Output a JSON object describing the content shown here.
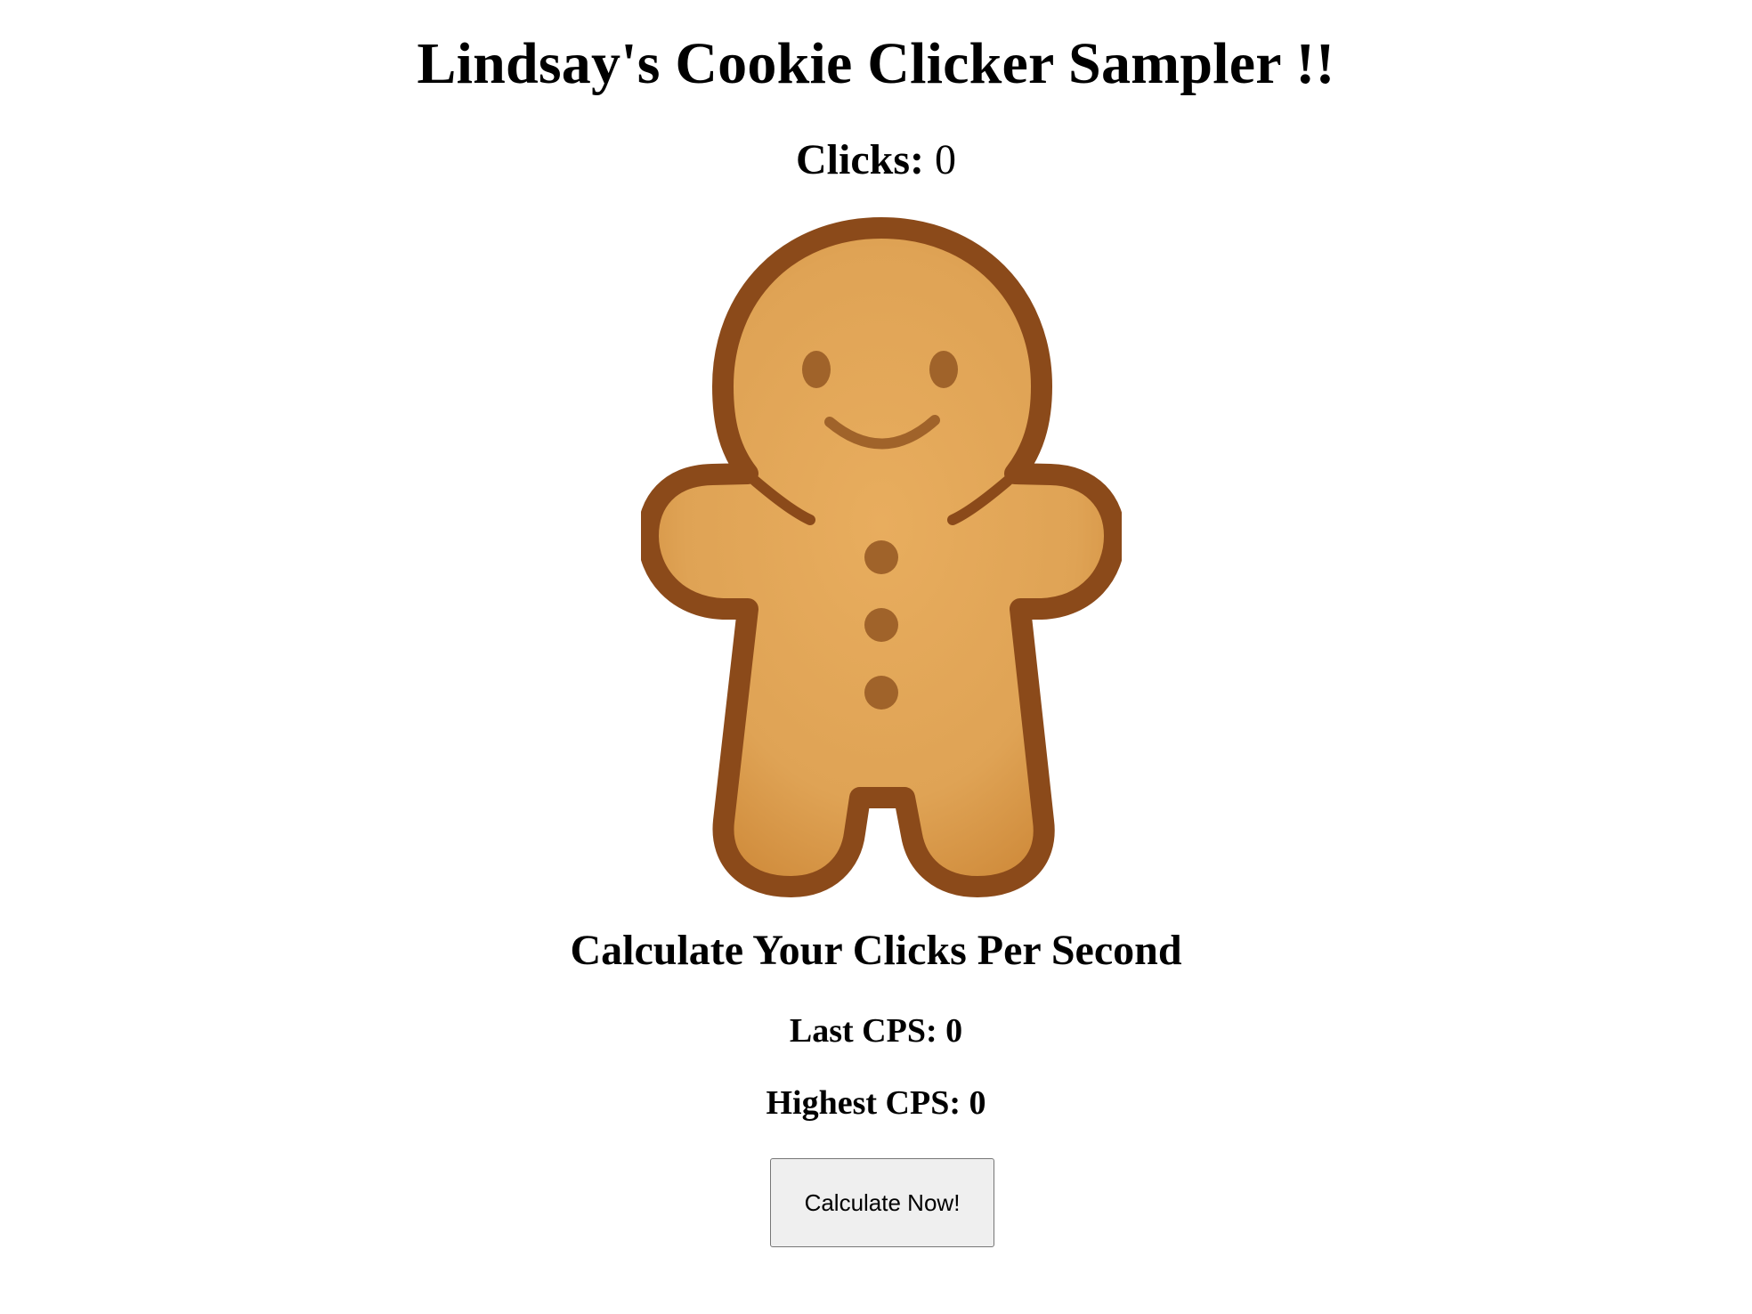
{
  "page": {
    "title": "Lindsay's Cookie Clicker Sampler !!",
    "clicks": {
      "label": "Clicks:",
      "value": "0"
    }
  },
  "cookie": {
    "icon": "gingerbread-man-icon",
    "colors": {
      "outline": "#8b4a1a",
      "dough": "#e3a85a",
      "features": "#a0632a"
    }
  },
  "cps": {
    "heading": "Calculate Your Clicks Per Second",
    "last_label": "Last CPS:",
    "last_value": "0",
    "highest_label": "Highest CPS:",
    "highest_value": "0",
    "button_label": "Calculate Now!"
  }
}
